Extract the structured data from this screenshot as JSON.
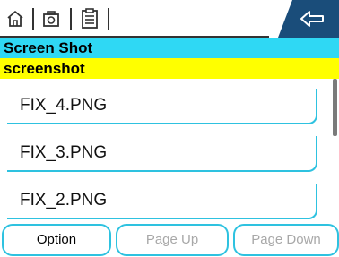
{
  "toolbar": {
    "icons": [
      "home-icon",
      "camera-icon",
      "document-icon"
    ],
    "back_icon": "back-arrow-icon",
    "accent_color": "#1a4d7a"
  },
  "folder": {
    "title": "Screen Shot",
    "path": "screenshot",
    "title_bg": "#2fd8f4",
    "path_bg": "#ffff00"
  },
  "files": [
    {
      "name": "FIX_4.PNG"
    },
    {
      "name": "FIX_3.PNG"
    },
    {
      "name": "FIX_2.PNG"
    }
  ],
  "buttons": {
    "option": "Option",
    "page_up": "Page Up",
    "page_down": "Page Down"
  }
}
